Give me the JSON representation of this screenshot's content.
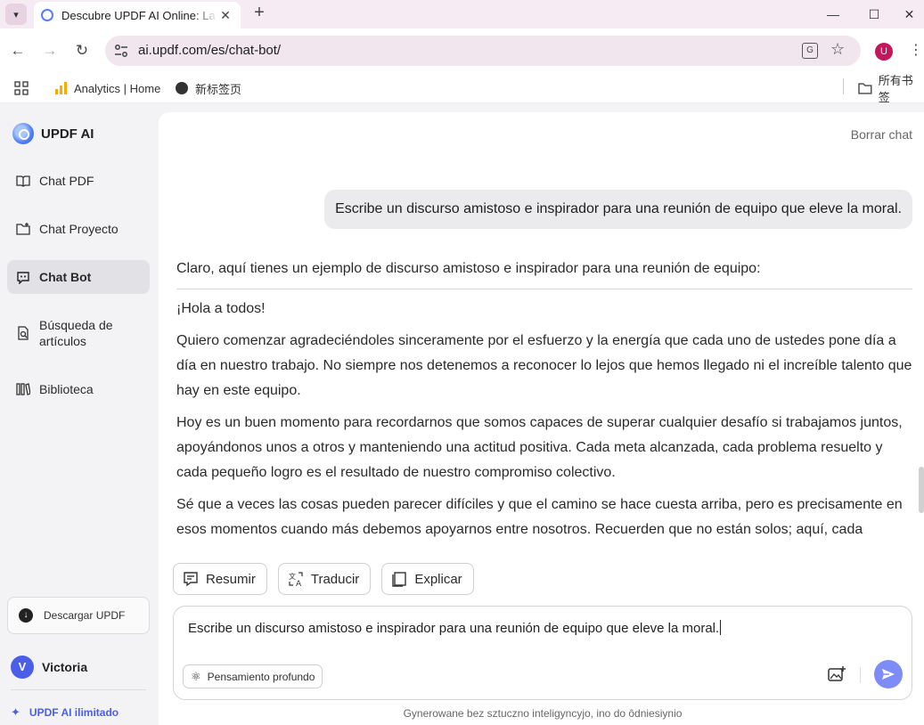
{
  "browser": {
    "tab_title": "Descubre UPDF AI Online: La",
    "url": "ai.updf.com/es/chat-bot/",
    "profile_initial": "U",
    "bookmarks": [
      {
        "label": "Analytics | Home",
        "icon": "analytics-icon"
      },
      {
        "label": "新标签页",
        "icon": "globe-icon"
      }
    ],
    "all_bookmarks": "所有书签"
  },
  "sidebar": {
    "brand": "UPDF AI",
    "items": [
      {
        "label": "Chat PDF",
        "icon": "book-icon",
        "active": false
      },
      {
        "label": "Chat Proyecto",
        "icon": "folder-icon",
        "active": false
      },
      {
        "label": "Chat Bot",
        "icon": "bot-icon",
        "active": true
      },
      {
        "label": "Búsqueda de artículos",
        "icon": "search-doc-icon",
        "active": false
      },
      {
        "label": "Biblioteca",
        "icon": "library-icon",
        "active": false
      }
    ],
    "download_label": "Descargar UPDF",
    "user_name": "Victoria",
    "user_initial": "V",
    "upgrade_label": "UPDF AI ilimitado"
  },
  "chat": {
    "clear_label": "Borrar chat",
    "user_message": "Escribe un discurso amistoso e inspirador para una reunión de equipo que eleve la moral.",
    "answer_intro": "Claro, aquí tienes un ejemplo de discurso amistoso e inspirador para una reunión de equipo:",
    "answer_paragraphs": [
      "¡Hola a todos!",
      "Quiero comenzar agradeciéndoles sinceramente por el esfuerzo y la energía que cada uno de ustedes pone día a día en nuestro trabajo. No siempre nos detenemos a reconocer lo lejos que hemos llegado ni el increíble talento que hay en este equipo.",
      "Hoy es un buen momento para recordarnos que somos capaces de superar cualquier desafío si trabajamos juntos, apoyándonos unos a otros y manteniendo una actitud positiva. Cada meta alcanzada, cada problema resuelto y cada pequeño logro es el resultado de nuestro compromiso colectivo.",
      "Sé que a veces las cosas pueden parecer difíciles y que el camino se hace cuesta arriba, pero es precisamente en esos momentos cuando más debemos apoyarnos entre nosotros. Recuerden que no están solos; aquí, cada"
    ],
    "actions": [
      "Resumir",
      "Traducir",
      "Explicar"
    ],
    "input_value": "Escribe un discurso amistoso e inspirador para una reunión de equipo que eleve la moral.",
    "deep_thinking_label": "Pensamiento profundo",
    "disclaimer": "Gynerowane bez sztucznо inteligyncyjo, ino do ôdniesiynio"
  },
  "colors": {
    "accent": "#4a5ee8",
    "send_button": "#7e8cf7",
    "chrome_bg": "#f6eaf3"
  }
}
